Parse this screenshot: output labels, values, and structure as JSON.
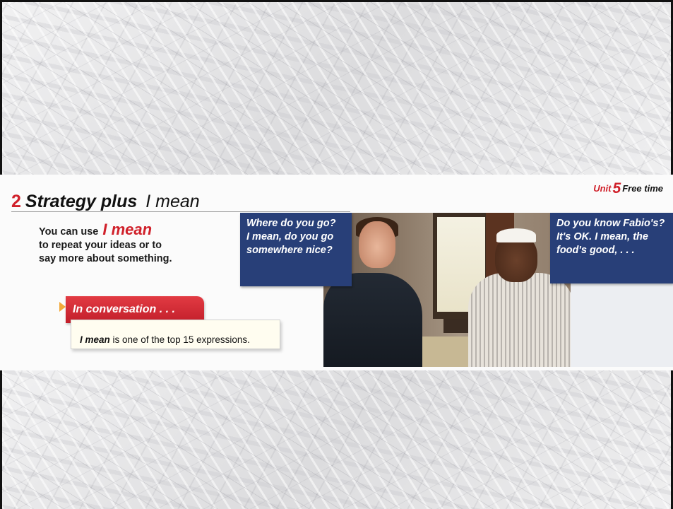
{
  "unit": {
    "word": "Unit",
    "number": "5",
    "title": "Free time"
  },
  "section": {
    "number": "2",
    "label": "Strategy plus",
    "topic": "I mean"
  },
  "intro": {
    "prefix": "You can use",
    "highlight": "I mean",
    "line2": "to repeat your ideas or to",
    "line3": "say more about something."
  },
  "conversation": {
    "heading": "In conversation . . .",
    "key": "I mean",
    "text": " is one of the top 15 expressions."
  },
  "bubbles": {
    "left": [
      "Where do you go?",
      "I mean, do you go",
      "somewhere nice?"
    ],
    "right": [
      "Do you know Fabio's?",
      "It's OK. I mean, the",
      "food's good, . . ."
    ]
  },
  "colors": {
    "accent_red": "#d0202a",
    "bubble_blue": "#283f78"
  }
}
